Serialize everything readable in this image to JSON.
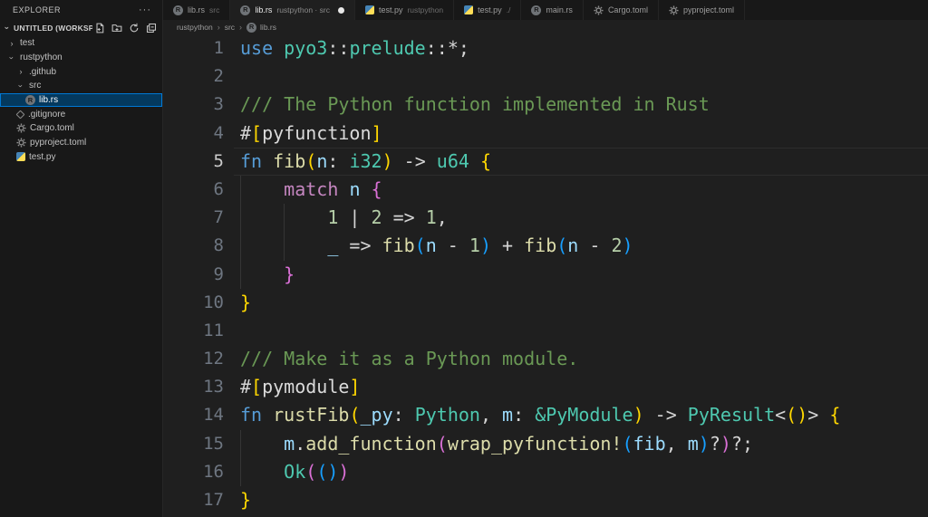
{
  "explorer": {
    "title": "EXPLORER",
    "workspace_label": "UNTITLED (WORKSPA...",
    "tree": [
      {
        "name": "test",
        "icon": "folder",
        "chevron": "collapsed",
        "indent": 0,
        "selected": false
      },
      {
        "name": "rustpython",
        "icon": "folder",
        "chevron": "expanded",
        "indent": 0,
        "selected": false
      },
      {
        "name": ".github",
        "icon": "folder",
        "chevron": "collapsed",
        "indent": 1,
        "selected": false
      },
      {
        "name": "src",
        "icon": "folder",
        "chevron": "expanded",
        "indent": 1,
        "selected": false
      },
      {
        "name": "lib.rs",
        "icon": "rust",
        "chevron": "none",
        "indent": 2,
        "selected": true
      },
      {
        "name": ".gitignore",
        "icon": "git",
        "chevron": "none",
        "indent": 1,
        "selected": false
      },
      {
        "name": "Cargo.toml",
        "icon": "gear",
        "chevron": "none",
        "indent": 1,
        "selected": false
      },
      {
        "name": "pyproject.toml",
        "icon": "gear",
        "chevron": "none",
        "indent": 1,
        "selected": false
      },
      {
        "name": "test.py",
        "icon": "python",
        "chevron": "none",
        "indent": 1,
        "selected": false
      }
    ]
  },
  "tabs": [
    {
      "label": "lib.rs",
      "desc": "src",
      "icon": "rust",
      "active": false,
      "dirty": false
    },
    {
      "label": "lib.rs",
      "desc": "rustpython · src",
      "icon": "rust",
      "active": true,
      "dirty": true
    },
    {
      "label": "test.py",
      "desc": "rustpython",
      "icon": "python",
      "active": false,
      "dirty": false
    },
    {
      "label": "test.py",
      "desc": "./",
      "icon": "python",
      "active": false,
      "dirty": false
    },
    {
      "label": "main.rs",
      "desc": "",
      "icon": "rust",
      "active": false,
      "dirty": false
    },
    {
      "label": "Cargo.toml",
      "desc": "",
      "icon": "gear",
      "active": false,
      "dirty": false
    },
    {
      "label": "pyproject.toml",
      "desc": "",
      "icon": "gear",
      "active": false,
      "dirty": false
    }
  ],
  "breadcrumb": [
    {
      "label": "rustpython",
      "icon": "none"
    },
    {
      "label": "src",
      "icon": "none"
    },
    {
      "label": "lib.rs",
      "icon": "rust"
    }
  ],
  "editor": {
    "lines": [
      {
        "num": 1,
        "current": false,
        "guides": [],
        "tokens": [
          [
            "kw",
            "use"
          ],
          [
            "pl",
            " "
          ],
          [
            "ty",
            "pyo3"
          ],
          [
            "pl",
            "::"
          ],
          [
            "ty",
            "prelude"
          ],
          [
            "pl",
            "::*;"
          ]
        ]
      },
      {
        "num": 2,
        "current": false,
        "guides": [],
        "tokens": []
      },
      {
        "num": 3,
        "current": false,
        "guides": [],
        "tokens": [
          [
            "cm",
            "/// The Python function implemented in Rust"
          ]
        ]
      },
      {
        "num": 4,
        "current": false,
        "guides": [],
        "tokens": [
          [
            "pl",
            "#"
          ],
          [
            "b1",
            "["
          ],
          [
            "attr",
            "pyfunction"
          ],
          [
            "b1",
            "]"
          ]
        ]
      },
      {
        "num": 5,
        "current": true,
        "guides": [],
        "tokens": [
          [
            "kw",
            "fn"
          ],
          [
            "pl",
            " "
          ],
          [
            "fn",
            "fib"
          ],
          [
            "b1",
            "("
          ],
          [
            "var",
            "n"
          ],
          [
            "pl",
            ": "
          ],
          [
            "ty",
            "i32"
          ],
          [
            "b1",
            ")"
          ],
          [
            "pl",
            " -> "
          ],
          [
            "ty",
            "u64"
          ],
          [
            "pl",
            " "
          ],
          [
            "b1",
            "{"
          ]
        ]
      },
      {
        "num": 6,
        "current": false,
        "guides": [
          0
        ],
        "tokens": [
          [
            "pl",
            "    "
          ],
          [
            "ctl",
            "match"
          ],
          [
            "pl",
            " "
          ],
          [
            "var",
            "n"
          ],
          [
            "pl",
            " "
          ],
          [
            "b2",
            "{"
          ]
        ]
      },
      {
        "num": 7,
        "current": false,
        "guides": [
          0,
          4
        ],
        "tokens": [
          [
            "pl",
            "        "
          ],
          [
            "num",
            "1"
          ],
          [
            "pl",
            " | "
          ],
          [
            "num",
            "2"
          ],
          [
            "pl",
            " => "
          ],
          [
            "num",
            "1"
          ],
          [
            "pl",
            ","
          ]
        ]
      },
      {
        "num": 8,
        "current": false,
        "guides": [
          0,
          4
        ],
        "tokens": [
          [
            "pl",
            "        "
          ],
          [
            "var",
            "_"
          ],
          [
            "pl",
            " => "
          ],
          [
            "fn",
            "fib"
          ],
          [
            "b3",
            "("
          ],
          [
            "var",
            "n"
          ],
          [
            "pl",
            " - "
          ],
          [
            "num",
            "1"
          ],
          [
            "b3",
            ")"
          ],
          [
            "pl",
            " + "
          ],
          [
            "fn",
            "fib"
          ],
          [
            "b3",
            "("
          ],
          [
            "var",
            "n"
          ],
          [
            "pl",
            " - "
          ],
          [
            "num",
            "2"
          ],
          [
            "b3",
            ")"
          ]
        ]
      },
      {
        "num": 9,
        "current": false,
        "guides": [
          0
        ],
        "tokens": [
          [
            "pl",
            "    "
          ],
          [
            "b2",
            "}"
          ]
        ]
      },
      {
        "num": 10,
        "current": false,
        "guides": [],
        "tokens": [
          [
            "b1",
            "}"
          ]
        ]
      },
      {
        "num": 11,
        "current": false,
        "guides": [],
        "tokens": []
      },
      {
        "num": 12,
        "current": false,
        "guides": [],
        "tokens": [
          [
            "cm",
            "/// Make it as a Python module."
          ]
        ]
      },
      {
        "num": 13,
        "current": false,
        "guides": [],
        "tokens": [
          [
            "pl",
            "#"
          ],
          [
            "b1",
            "["
          ],
          [
            "attr",
            "pymodule"
          ],
          [
            "b1",
            "]"
          ]
        ]
      },
      {
        "num": 14,
        "current": false,
        "guides": [],
        "tokens": [
          [
            "kw",
            "fn"
          ],
          [
            "pl",
            " "
          ],
          [
            "fn",
            "rustFib"
          ],
          [
            "b1",
            "("
          ],
          [
            "var",
            "_py"
          ],
          [
            "pl",
            ": "
          ],
          [
            "ty",
            "Python"
          ],
          [
            "pl",
            ", "
          ],
          [
            "var",
            "m"
          ],
          [
            "pl",
            ": "
          ],
          [
            "ty",
            "&PyModule"
          ],
          [
            "b1",
            ")"
          ],
          [
            "pl",
            " -> "
          ],
          [
            "ty",
            "PyResult"
          ],
          [
            "pl",
            "<"
          ],
          [
            "b1",
            "("
          ],
          [
            "b1",
            ")"
          ],
          [
            "pl",
            "> "
          ],
          [
            "b1",
            "{"
          ]
        ]
      },
      {
        "num": 15,
        "current": false,
        "guides": [
          0
        ],
        "tokens": [
          [
            "pl",
            "    "
          ],
          [
            "var",
            "m"
          ],
          [
            "pl",
            "."
          ],
          [
            "fn",
            "add_function"
          ],
          [
            "b2",
            "("
          ],
          [
            "fn",
            "wrap_pyfunction!"
          ],
          [
            "b3",
            "("
          ],
          [
            "var",
            "fib"
          ],
          [
            "pl",
            ", "
          ],
          [
            "var",
            "m"
          ],
          [
            "b3",
            ")"
          ],
          [
            "pl",
            "?"
          ],
          [
            "b2",
            ")"
          ],
          [
            "pl",
            "?;"
          ]
        ]
      },
      {
        "num": 16,
        "current": false,
        "guides": [
          0
        ],
        "tokens": [
          [
            "pl",
            "    "
          ],
          [
            "ty",
            "Ok"
          ],
          [
            "b2",
            "("
          ],
          [
            "b3",
            "("
          ],
          [
            "b3",
            ")"
          ],
          [
            "b2",
            ")"
          ]
        ]
      },
      {
        "num": 17,
        "current": false,
        "guides": [],
        "tokens": [
          [
            "b1",
            "}"
          ]
        ]
      }
    ]
  },
  "colors": {
    "editor_bg": "#1f1f1f",
    "sidebar_bg": "#181818",
    "selection_bg": "#04395e",
    "selection_border": "#0078d4",
    "keyword": "#569cd6",
    "control": "#c586c0",
    "type": "#4ec9b0",
    "function": "#dcdcaa",
    "variable": "#9cdcfe",
    "number": "#b5cea8",
    "comment": "#6a9955",
    "bracket1": "#ffd700",
    "bracket2": "#da70d6",
    "bracket3": "#179fff"
  }
}
